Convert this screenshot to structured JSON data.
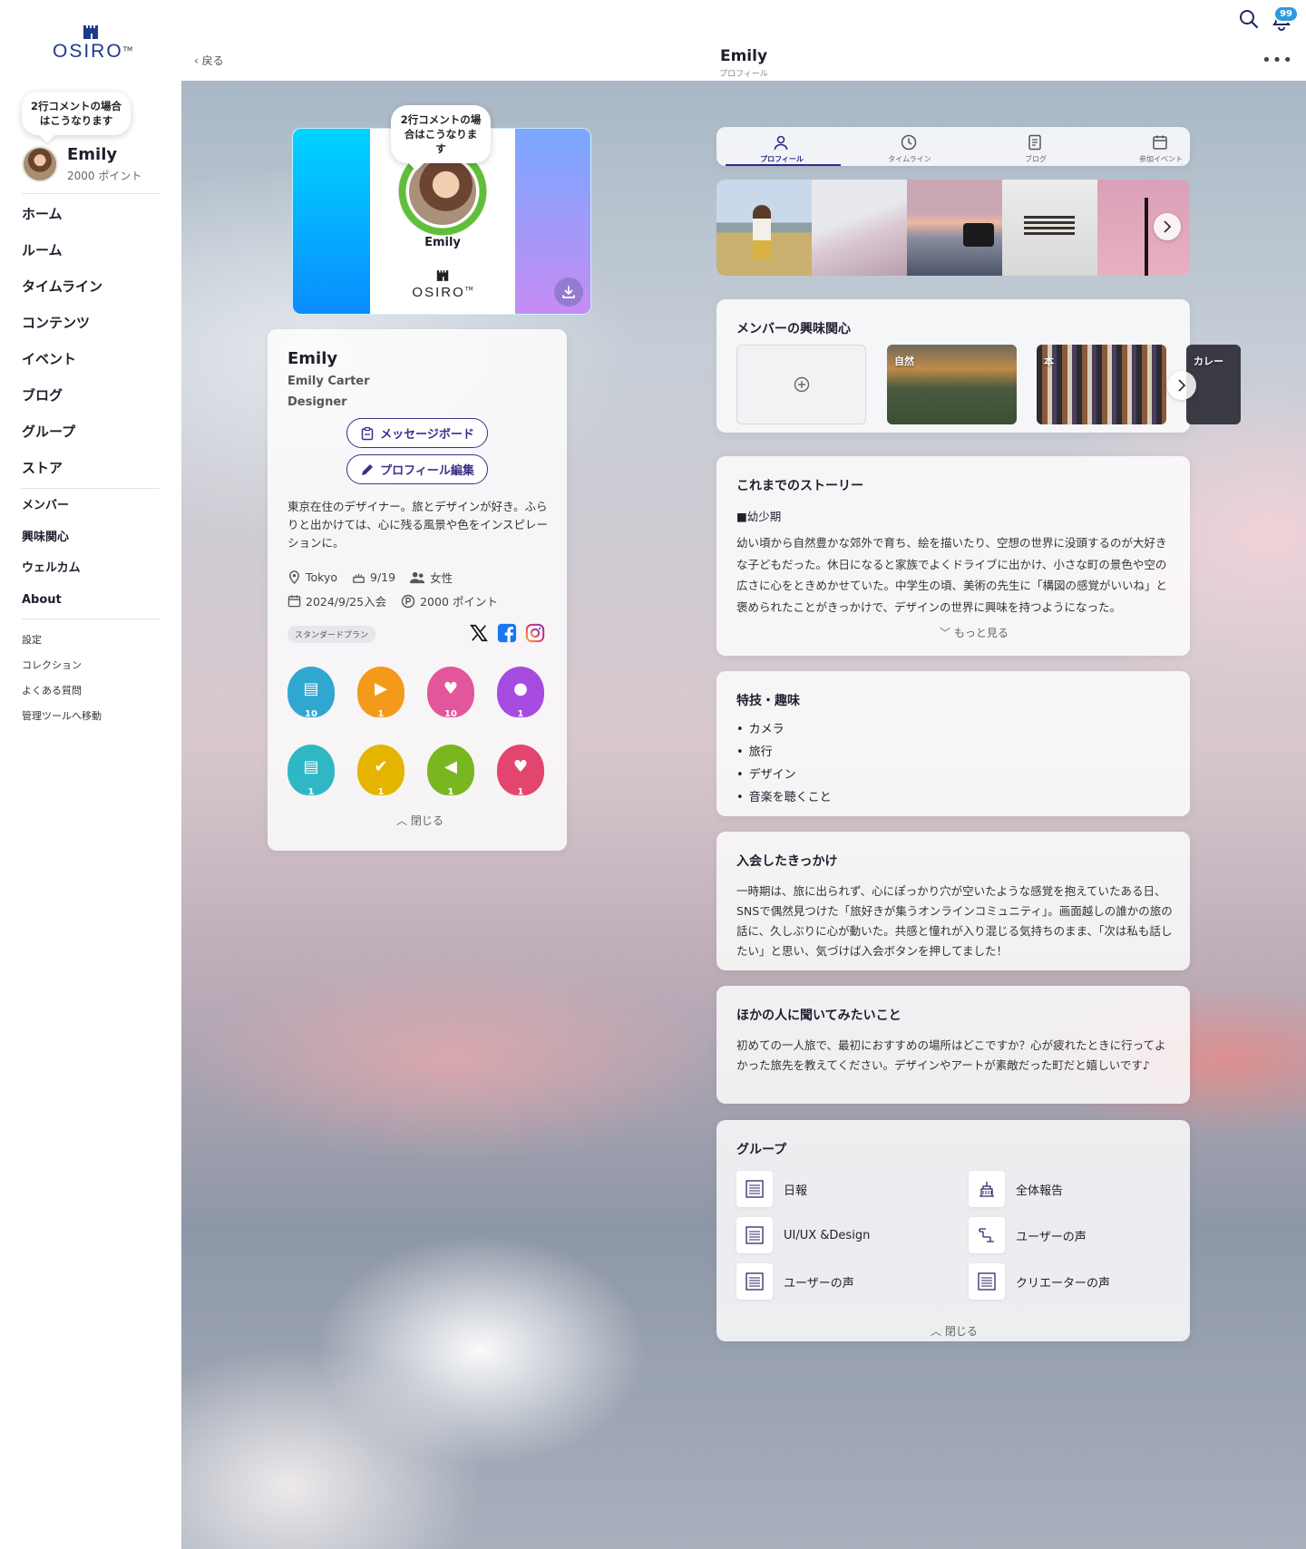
{
  "brand": {
    "name": "OSIRO"
  },
  "sidebar": {
    "speech": "2行コメントの場合はこうなります",
    "user": {
      "name": "Emily",
      "points": "2000 ポイント"
    },
    "main_nav": [
      "ホーム",
      "ルーム",
      "タイムライン",
      "コンテンツ",
      "イベント",
      "ブログ",
      "グループ",
      "ストア"
    ],
    "sub_nav": [
      "メンバー",
      "興味関心",
      "ウェルカム",
      "About"
    ],
    "misc_nav": [
      "設定",
      "コレクション",
      "よくある質問",
      "管理ツールへ移動"
    ]
  },
  "header": {
    "back": "戻る",
    "title": "Emily",
    "subtitle": "プロフィール",
    "notification_count": "99",
    "icons": [
      "search-icon",
      "bell-icon",
      "more-icon"
    ]
  },
  "profile_card": {
    "speech": "2行コメントの場合はこうなります",
    "name": "Emily",
    "logo": "OSIRO"
  },
  "profile": {
    "display_name": "Emily",
    "full_name": "Emily Carter",
    "job": "Designer",
    "message_board": "メッセージボード",
    "edit_profile": "プロフィール編集",
    "bio": "東京在住のデザイナー。旅とデザインが好き。ふらりと出かけては、心に残る風景や色をインスピレーションに。",
    "location": "Tokyo",
    "birthday": "9/19",
    "gender": "女性",
    "joined": "2024/9/25入会",
    "points": "2000 ポイント",
    "plan": "スタンダードプラン",
    "close": "閉じる",
    "badges": [
      {
        "count": "10",
        "color": "#2fa7cf",
        "icon": "book-icon"
      },
      {
        "count": "1",
        "color": "#f39a1b",
        "icon": "video-icon"
      },
      {
        "count": "10",
        "color": "#e4569c",
        "icon": "heart-icon"
      },
      {
        "count": "1",
        "color": "#a64be0",
        "icon": "chat-icon"
      },
      {
        "count": "1",
        "color": "#30b7c6",
        "icon": "book-icon"
      },
      {
        "count": "1",
        "color": "#e5b400",
        "icon": "calendar-check-icon"
      },
      {
        "count": "1",
        "color": "#79b721",
        "icon": "megaphone-icon"
      },
      {
        "count": "1",
        "color": "#e2456d",
        "icon": "heart-icon"
      }
    ]
  },
  "tabs": [
    {
      "label": "プロフィール",
      "icon": "person-icon"
    },
    {
      "label": "タイムライン",
      "icon": "clock-icon"
    },
    {
      "label": "ブログ",
      "icon": "document-icon"
    },
    {
      "label": "参加イベント",
      "icon": "calendar-icon"
    }
  ],
  "interests": {
    "title": "メンバーの興味関心",
    "items": [
      "自然",
      "本",
      "カレー"
    ]
  },
  "story": {
    "title": "これまでのストーリー",
    "heading": "■幼少期",
    "body": "幼い頃から自然豊かな郊外で育ち、絵を描いたり、空想の世界に没頭するのが大好きな子どもだった。休日になると家族でよくドライブに出かけ、小さな町の景色や空の広さに心をときめかせていた。中学生の頃、美術の先生に「構図の感覚がいいね」と褒められたことがきっかけで、デザインの世界に興味を持つようになった。",
    "more": "もっと見る"
  },
  "skills": {
    "title": "特技・趣味",
    "items": [
      "カメラ",
      "旅行",
      "デザイン",
      "音楽を聴くこと"
    ]
  },
  "reason": {
    "title": "入会したきっかけ",
    "body": "一時期は、旅に出られず、心にぽっかり穴が空いたような感覚を抱えていたある日、SNSで偶然見つけた「旅好きが集うオンラインコミュニティ」。画面越しの誰かの旅の話に、久しぶりに心が動いた。共感と憧れが入り混じる気持ちのまま、「次は私も話したい」と思い、気づけば入会ボタンを押してました！"
  },
  "ask": {
    "title": "ほかの人に聞いてみたいこと",
    "body": "初めての一人旅で、最初におすすめの場所はどこですか？心が疲れたときに行ってよかった旅先を教えてください。デザインやアートが素敵だった町だと嬉しいです♪"
  },
  "groups": {
    "title": "グループ",
    "items": [
      "日報",
      "全体報告",
      "UI/UX &Design",
      "ユーザーの声",
      "ユーザーの声",
      "クリエーターの声"
    ],
    "close": "閉じる"
  }
}
